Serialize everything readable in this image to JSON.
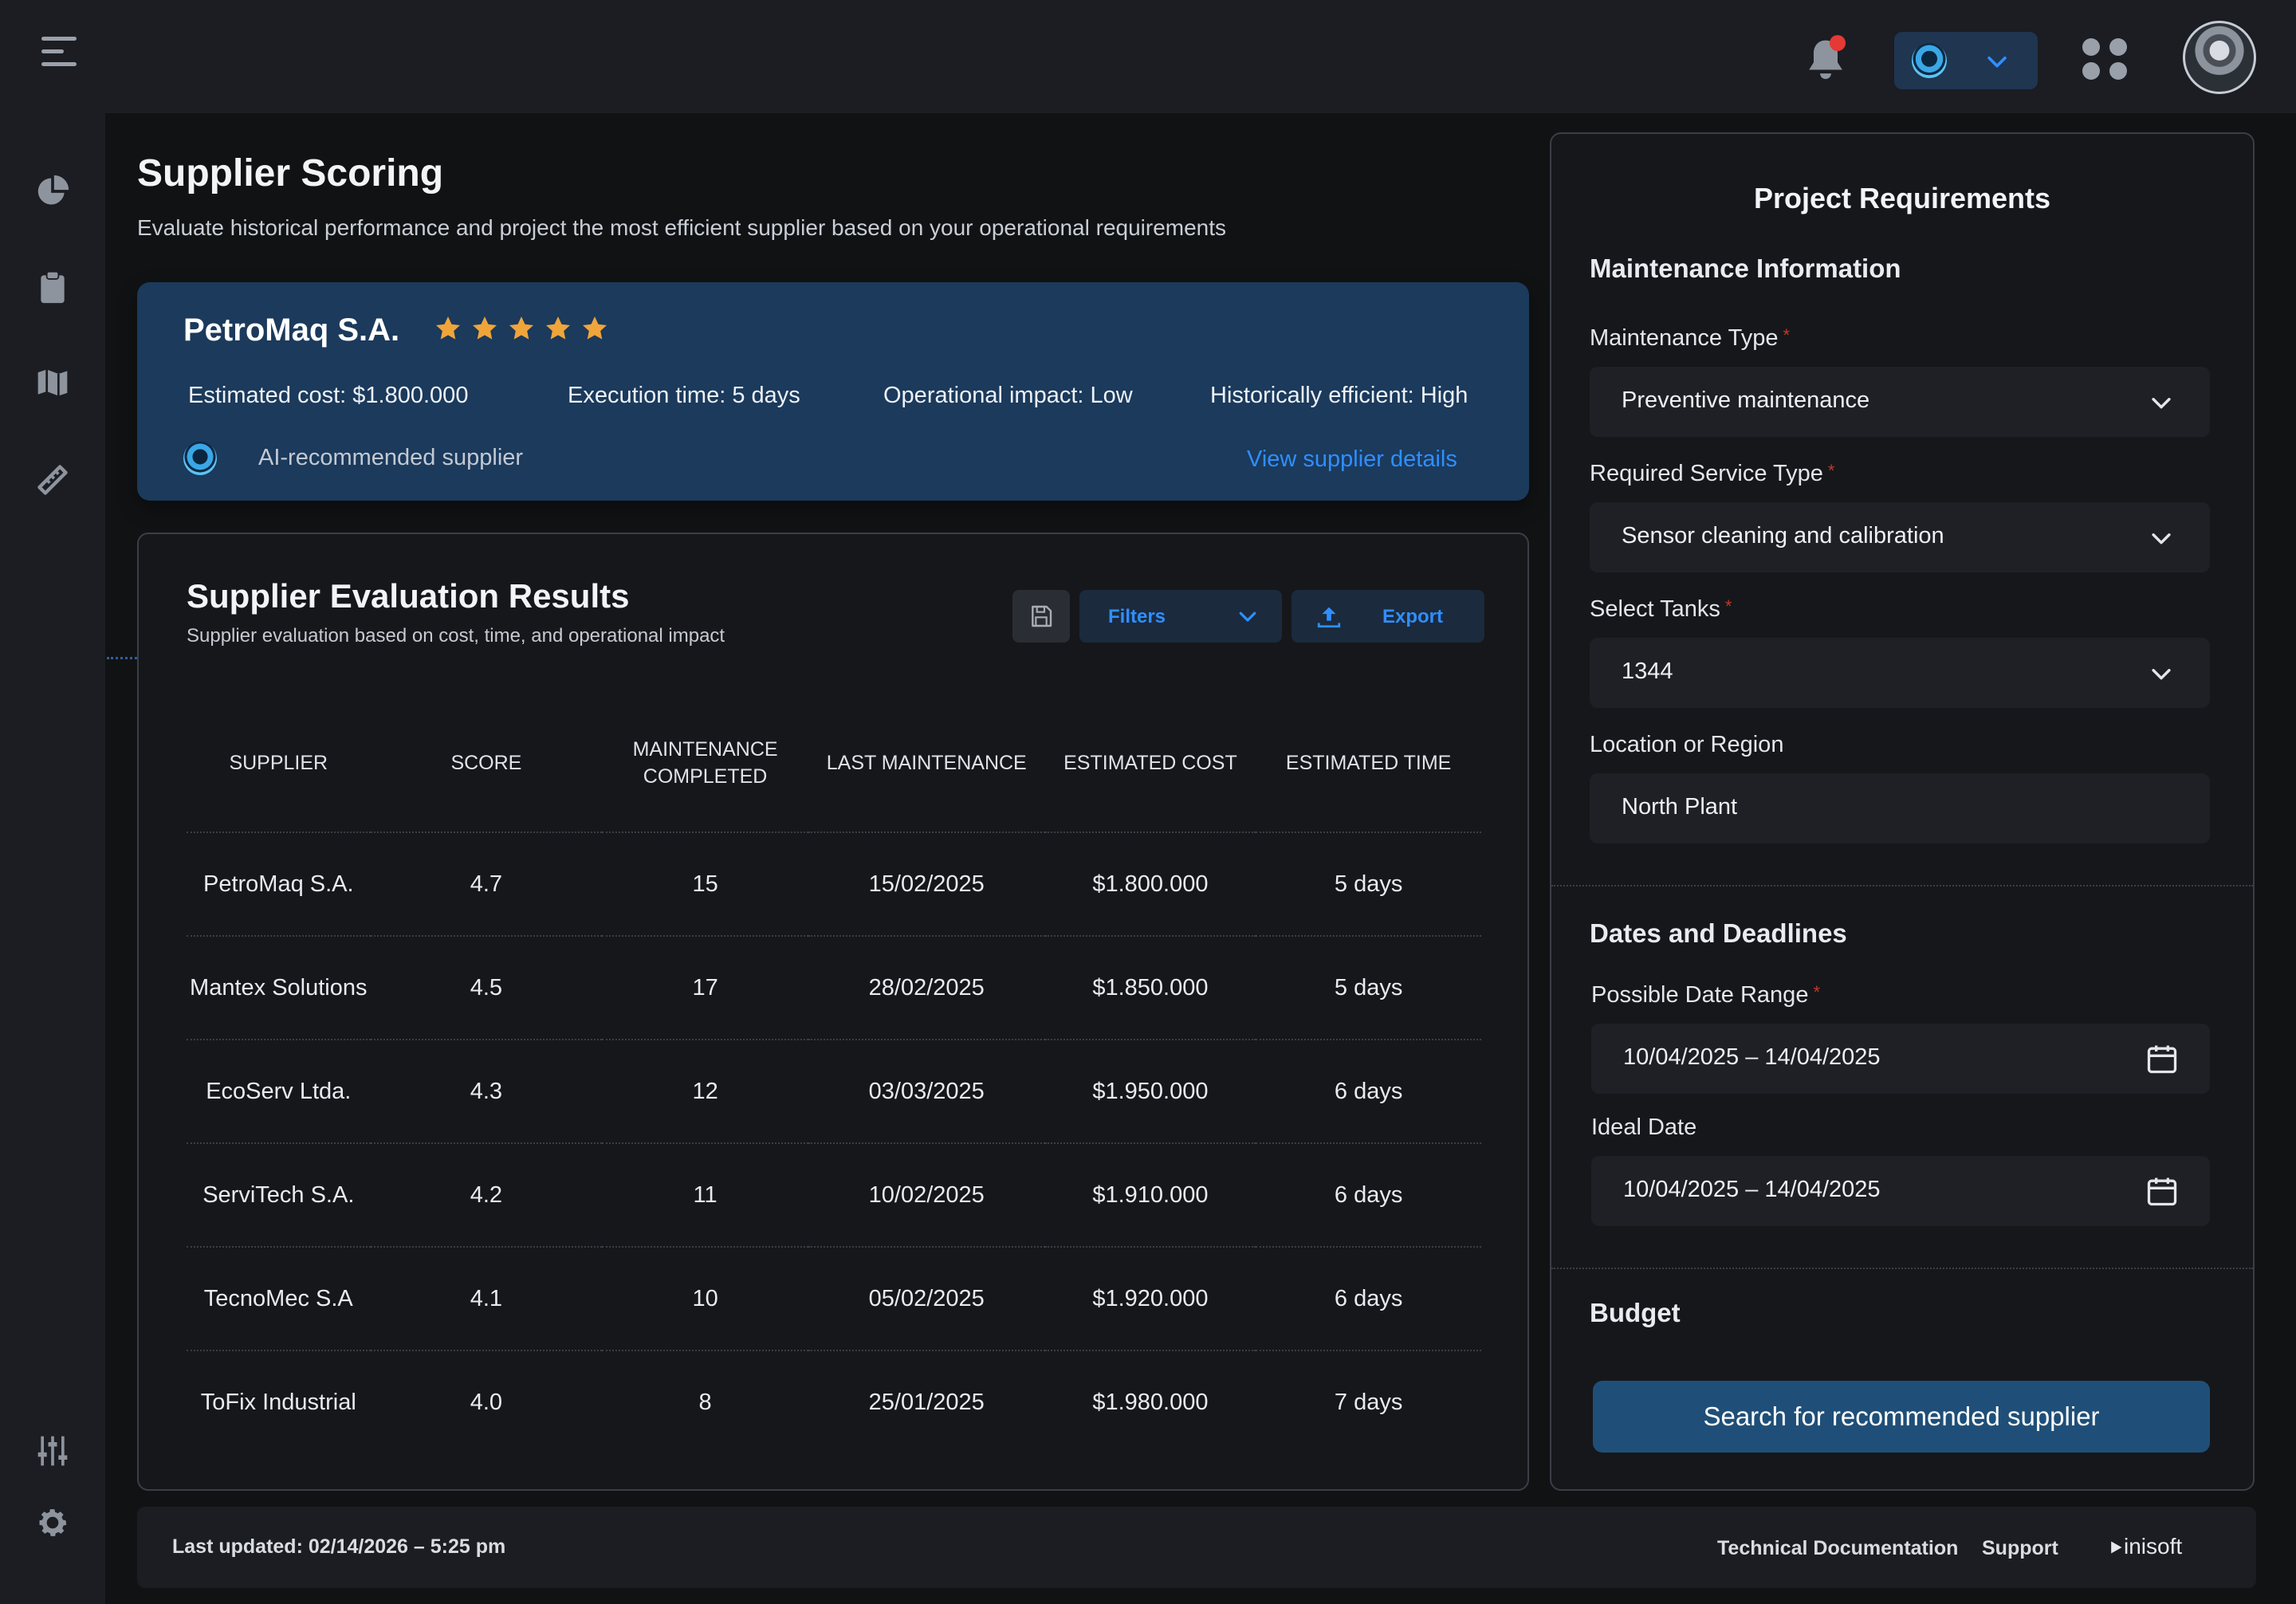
{
  "header": {
    "menu_icon": "hamburger-icon",
    "notification_icon": "bell-icon",
    "ai_assistant_icon": "ai-orb-icon",
    "apps_icon": "grid-icon"
  },
  "sidebar": {
    "items": [
      {
        "icon": "pie-chart-icon"
      },
      {
        "icon": "clipboard-icon"
      },
      {
        "icon": "map-icon"
      },
      {
        "icon": "ruler-icon"
      },
      {
        "icon": "sliders-icon"
      },
      {
        "icon": "gear-icon"
      }
    ]
  },
  "page": {
    "title": "Supplier Scoring",
    "subtitle": "Evaluate historical performance and project the most efficient supplier based on your operational requirements"
  },
  "recommendation": {
    "supplier": "PetroMaq S.A.",
    "rating": 5,
    "estimated_cost": "Estimated cost: $1.800.000",
    "execution_time": "Execution time: 5 days",
    "operational_impact": "Operational impact: Low",
    "historically_efficient": "Historically efficient: High",
    "ai_label": "AI-recommended supplier",
    "view_details": "View supplier details"
  },
  "results": {
    "title": "Supplier Evaluation Results",
    "subtitle": "Supplier evaluation based on cost, time, and operational impact",
    "filters_label": "Filters",
    "export_label": "Export",
    "columns": [
      "SUPPLIER",
      "SCORE",
      "MAINTENANCE COMPLETED",
      "LAST MAINTENANCE",
      "ESTIMATED COST",
      "ESTIMATED TIME"
    ],
    "rows": [
      [
        "PetroMaq S.A.",
        "4.7",
        "15",
        "15/02/2025",
        "$1.800.000",
        "5 days"
      ],
      [
        "Mantex Solutions",
        "4.5",
        "17",
        "28/02/2025",
        "$1.850.000",
        "5 days"
      ],
      [
        "EcoServ Ltda.",
        "4.3",
        "12",
        "03/03/2025",
        "$1.950.000",
        "6 days"
      ],
      [
        "ServiTech S.A.",
        "4.2",
        "11",
        "10/02/2025",
        "$1.910.000",
        "6 days"
      ],
      [
        "TecnoMec S.A",
        "4.1",
        "10",
        "05/02/2025",
        "$1.920.000",
        "6 days"
      ],
      [
        "ToFix Industrial",
        "4.0",
        "8",
        "25/01/2025",
        "$1.980.000",
        "7 days"
      ]
    ]
  },
  "requirements": {
    "title": "Project Requirements",
    "maintenance_section": "Maintenance Information",
    "maintenance_type_label": "Maintenance Type",
    "maintenance_type_value": "Preventive maintenance",
    "service_type_label": "Required Service Type",
    "service_type_value": "Sensor cleaning and calibration",
    "tanks_label": "Select Tanks",
    "tanks_value": "1344",
    "location_label": "Location or Region",
    "location_value": "North Plant",
    "dates_section": "Dates and Deadlines",
    "date_range_label": "Possible Date Range",
    "date_range_value": "10/04/2025 – 14/04/2025",
    "ideal_date_label": "Ideal Date",
    "ideal_date_value": "10/04/2025 – 14/04/2025",
    "budget_section": "Budget",
    "search_button": "Search for recommended supplier",
    "required_mark": "*"
  },
  "footer": {
    "last_updated": "Last updated: 02/14/2026 – 5:25 pm",
    "tech_docs": "Technical Documentation",
    "support": "Support",
    "brand": "inisoft"
  },
  "colors": {
    "accent": "#2f8fff",
    "card_blue": "#1b3a5c",
    "primary_button": "#1f4f78",
    "star": "#f0a53a",
    "required": "#c0392b"
  }
}
